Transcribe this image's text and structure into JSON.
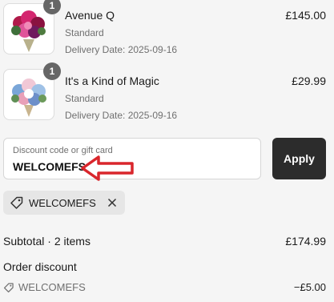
{
  "cart": {
    "items": [
      {
        "quantity": "1",
        "name": "Avenue Q",
        "variant": "Standard",
        "delivery": "Delivery Date: 2025-09-16",
        "price": "£145.00"
      },
      {
        "quantity": "1",
        "name": "It's a Kind of Magic",
        "variant": "Standard",
        "delivery": "Delivery Date: 2025-09-16",
        "price": "£29.99"
      }
    ]
  },
  "discount": {
    "label": "Discount code or gift card",
    "value": "WELCOMEFS",
    "apply_label": "Apply",
    "applied_tag": "WELCOMEFS",
    "annotation_color": "#d9262c"
  },
  "summary": {
    "subtotal_label": "Subtotal · 2 items",
    "subtotal_value": "£174.99",
    "order_discount_label": "Order discount",
    "discount_code": "WELCOMEFS",
    "discount_value": "−£5.00"
  },
  "icons": {
    "tag": "tag-icon",
    "remove": "close-icon",
    "arrow": "red-arrow-icon"
  },
  "colors": {
    "apply_button": "#2c2c2c",
    "qty_badge": "#666666"
  }
}
